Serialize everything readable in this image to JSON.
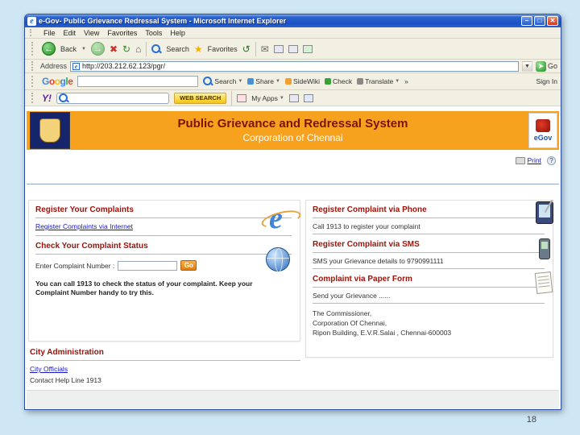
{
  "slide": {
    "page_number": "18"
  },
  "browser": {
    "title": "e-Gov- Public Grievance Redressal System - Microsoft Internet Explorer",
    "menu_items": [
      "File",
      "Edit",
      "View",
      "Favorites",
      "Tools",
      "Help"
    ],
    "toolbar": {
      "back_label": "Back",
      "search_label": "Search",
      "favorites_label": "Favorites"
    },
    "address": {
      "label": "Address",
      "value": "http://203.212.62.123/pgr/",
      "go_label": "Go"
    },
    "google_bar": {
      "logo_letters": [
        "G",
        "o",
        "o",
        "g",
        "l",
        "e"
      ],
      "search_label": "Search",
      "share_label": "Share",
      "sidewiki_label": "SideWiki",
      "check_label": "Check",
      "translate_label": "Translate",
      "overflow_label": "»",
      "signin_label": "Sign In"
    },
    "yahoo_bar": {
      "logo": "Y!",
      "web_search_label": "WEB SEARCH",
      "my_apps_label": "My Apps"
    }
  },
  "page": {
    "header": {
      "title": "Public Grievance and Redressal System",
      "subtitle": "Corporation of Chennai",
      "right_logo_label": "eGov"
    },
    "print_label": "Print",
    "help_badge": "?",
    "left_panel": {
      "register_heading": "Register Your Complaints",
      "register_link": "Register Complaints via Internet",
      "status_heading": "Check Your Complaint Status",
      "complaint_number_label": "Enter Complaint Number :",
      "go_button_label": "Go",
      "status_note": "You can call 1913 to check the status of your complaint. Keep your Complaint Number handy to try this."
    },
    "right_panel": {
      "phone_heading": "Register Complaint via Phone",
      "phone_text": "Call 1913 to register your complaint",
      "sms_heading": "Register Complaint via SMS",
      "sms_text": "SMS your Grievance details to 9790991111",
      "paper_heading": "Complaint via Paper Form",
      "paper_text": "Send your Grievance ......",
      "address_lines": [
        "The Commissioner,",
        "Corporation Of Chennai,",
        "Ripon Building, E.V.R.Salai , Chennai-600003"
      ]
    },
    "city_section": {
      "heading": "City Administration",
      "officials_link": "City Officials",
      "help_line": "Contact Help Line 1913"
    }
  }
}
